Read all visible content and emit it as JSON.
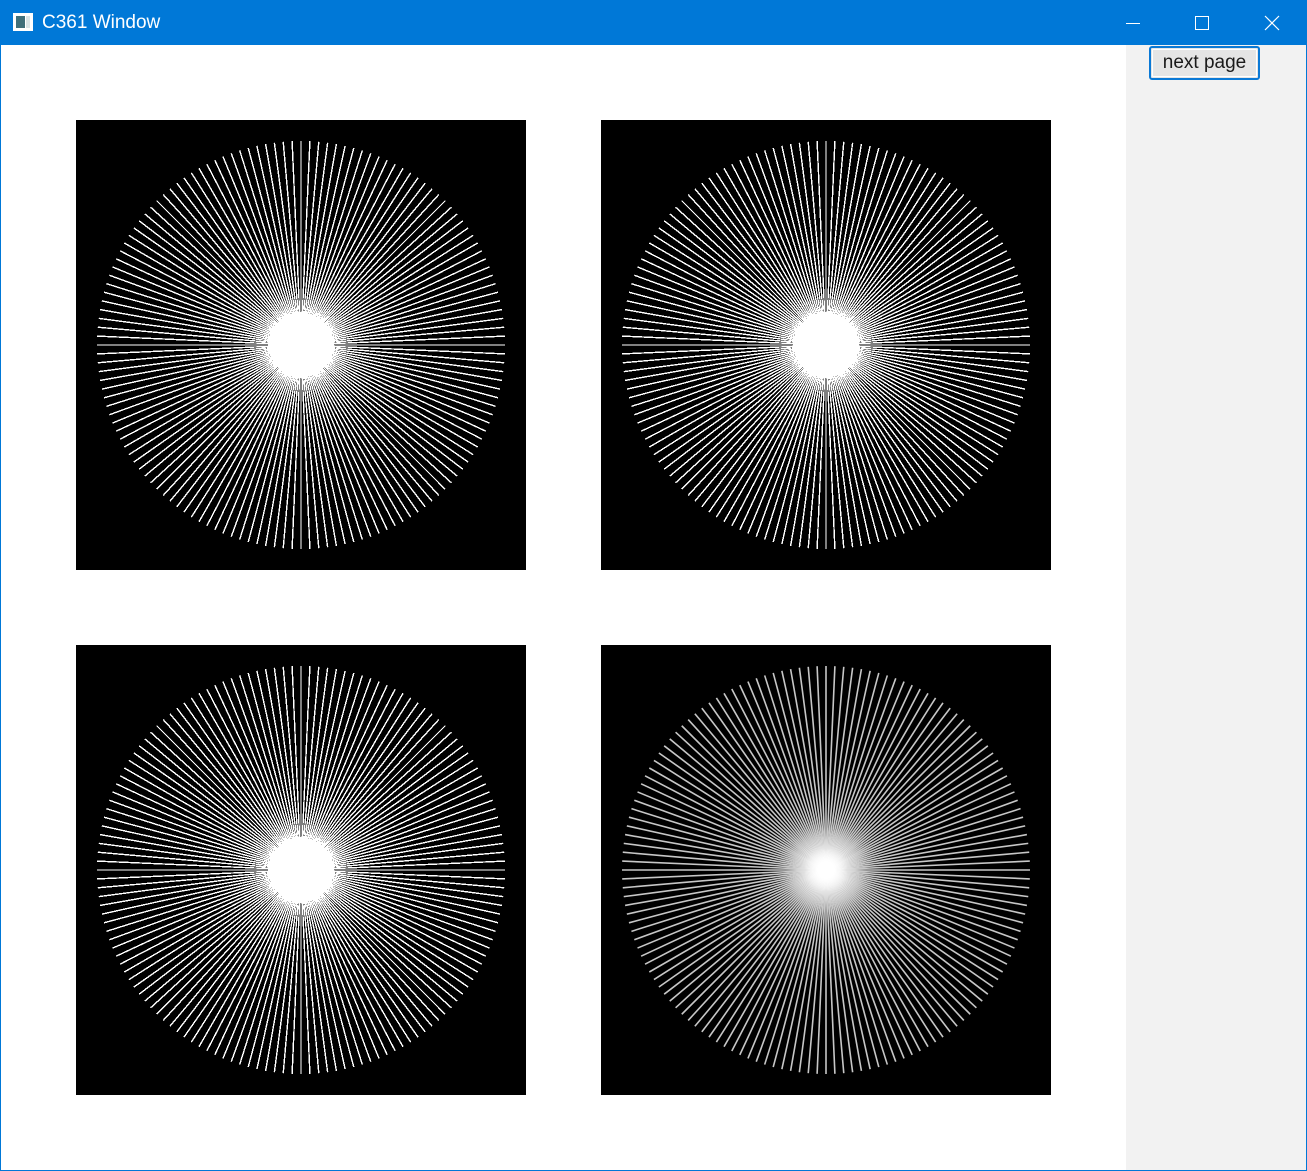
{
  "window": {
    "title": "C361 Window",
    "controls": {
      "minimize_icon": "minimize-icon",
      "maximize_icon": "maximize-icon",
      "close_icon": "close-icon"
    }
  },
  "sidebar": {
    "next_page_label": "next page"
  },
  "images": [
    {
      "name": "radial-lines-top-left",
      "pattern": "starburst",
      "spokes": 144,
      "rendering": "aliased"
    },
    {
      "name": "radial-lines-top-right",
      "pattern": "starburst",
      "spokes": 144,
      "rendering": "aliased"
    },
    {
      "name": "radial-lines-bottom-left",
      "pattern": "starburst",
      "spokes": 144,
      "rendering": "aliased"
    },
    {
      "name": "radial-lines-bottom-right",
      "pattern": "starburst",
      "spokes": 144,
      "rendering": "antialiased"
    }
  ],
  "colors": {
    "titlebar": "#0078d7",
    "panel_background": "#000000",
    "spoke": "#ffffff",
    "sidebar": "#f2f2f2"
  }
}
